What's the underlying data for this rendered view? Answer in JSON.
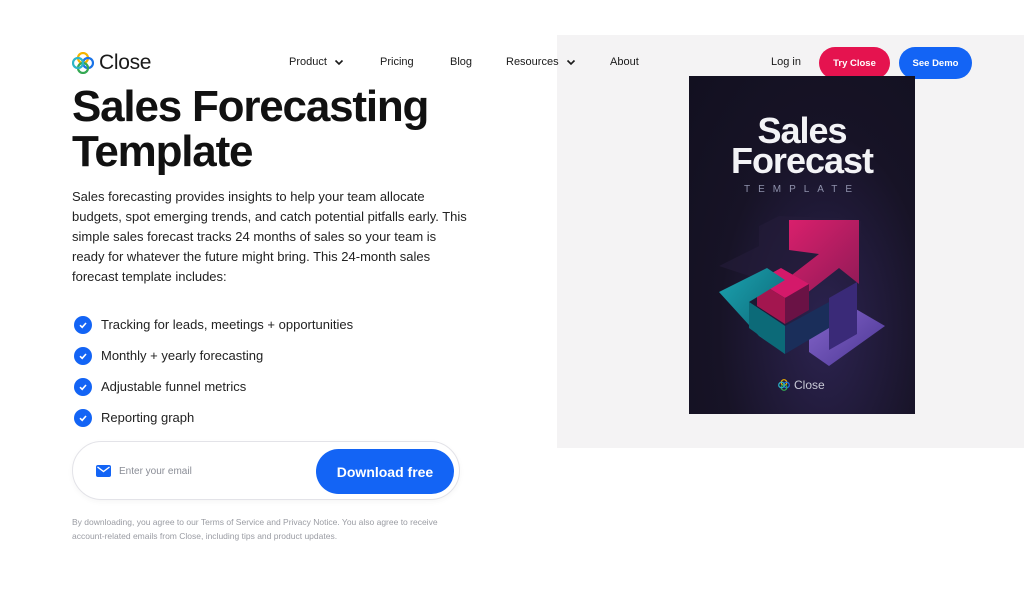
{
  "nav": {
    "logo_text": "Close",
    "items": [
      {
        "label": "Product",
        "dropdown": true
      },
      {
        "label": "Pricing",
        "dropdown": false
      },
      {
        "label": "Blog",
        "dropdown": false
      },
      {
        "label": "Resources",
        "dropdown": true
      },
      {
        "label": "About",
        "dropdown": false
      }
    ],
    "login_label": "Log in",
    "try_label": "Try Close",
    "demo_label": "See Demo"
  },
  "hero": {
    "title_line1": "Sales Forecasting",
    "title_line2": "Template",
    "description": "Sales forecasting provides insights to help your team allocate budgets, spot emerging trends, and catch potential pitfalls early. This simple sales forecast tracks 24 months of sales so your team is ready for whatever the future might bring. This 24-month sales forecast template includes:",
    "features": [
      "Tracking for leads, meetings + opportunities",
      "Monthly + yearly forecasting",
      "Adjustable funnel metrics",
      "Reporting graph"
    ]
  },
  "form": {
    "email_placeholder": "Enter your email",
    "email_value": "",
    "download_label": "Download free",
    "disclaimer": "By downloading, you agree to our Terms of Service and Privacy Notice. You also agree to receive account-related emails from Close, including tips and product updates."
  },
  "cover": {
    "title_line1": "Sales",
    "title_line2": "Forecast",
    "subtitle": "TEMPLATE",
    "brand": "Close"
  },
  "colors": {
    "primary_blue": "#1364f5",
    "try_red": "#e5134f",
    "panel_bg": "#f4f3f4"
  },
  "icons": [
    "close-logo-icon",
    "chevron-down-icon",
    "check-circle-icon",
    "mail-icon"
  ]
}
